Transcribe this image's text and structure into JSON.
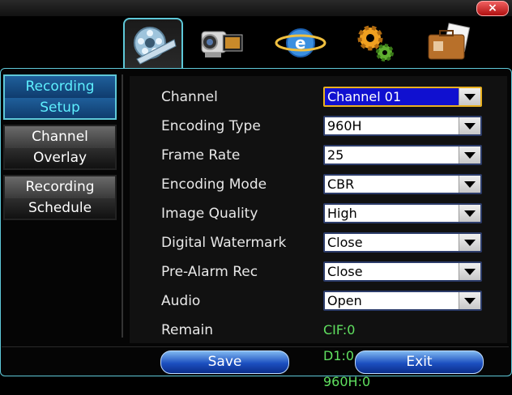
{
  "window": {
    "close_label": "×"
  },
  "tabs": [
    {
      "icon": "video-reel-icon",
      "active": true
    },
    {
      "icon": "camcorder-icon",
      "active": false
    },
    {
      "icon": "network-globe-icon",
      "active": false
    },
    {
      "icon": "gears-icon",
      "active": false
    },
    {
      "icon": "briefcase-icon",
      "active": false
    }
  ],
  "sidebar": {
    "items": [
      {
        "line1": "Recording",
        "line2": "Setup",
        "active": true
      },
      {
        "line1": "Channel",
        "line2": "Overlay",
        "active": false
      },
      {
        "line1": "Recording",
        "line2": "Schedule",
        "active": false
      }
    ]
  },
  "form": {
    "channel": {
      "label": "Channel",
      "value": "Channel 01"
    },
    "encoding_type": {
      "label": "Encoding Type",
      "value": "960H"
    },
    "frame_rate": {
      "label": "Frame Rate",
      "value": "25"
    },
    "encoding_mode": {
      "label": "Encoding Mode",
      "value": "CBR"
    },
    "image_quality": {
      "label": "Image Quality",
      "value": "High"
    },
    "digital_watermark": {
      "label": "Digital Watermark",
      "value": "Close"
    },
    "pre_alarm_rec": {
      "label": "Pre-Alarm Rec",
      "value": "Close"
    },
    "audio": {
      "label": "Audio",
      "value": "Open"
    },
    "remain": {
      "label": "Remain",
      "value": "CIF:0 D1:0 960H:0"
    }
  },
  "buttons": {
    "save": "Save",
    "exit": "Exit"
  },
  "colors": {
    "accent": "#5ec8d8",
    "remain_text": "#60e060",
    "focus_border": "#e8b020",
    "focus_fill": "#1010d0"
  }
}
